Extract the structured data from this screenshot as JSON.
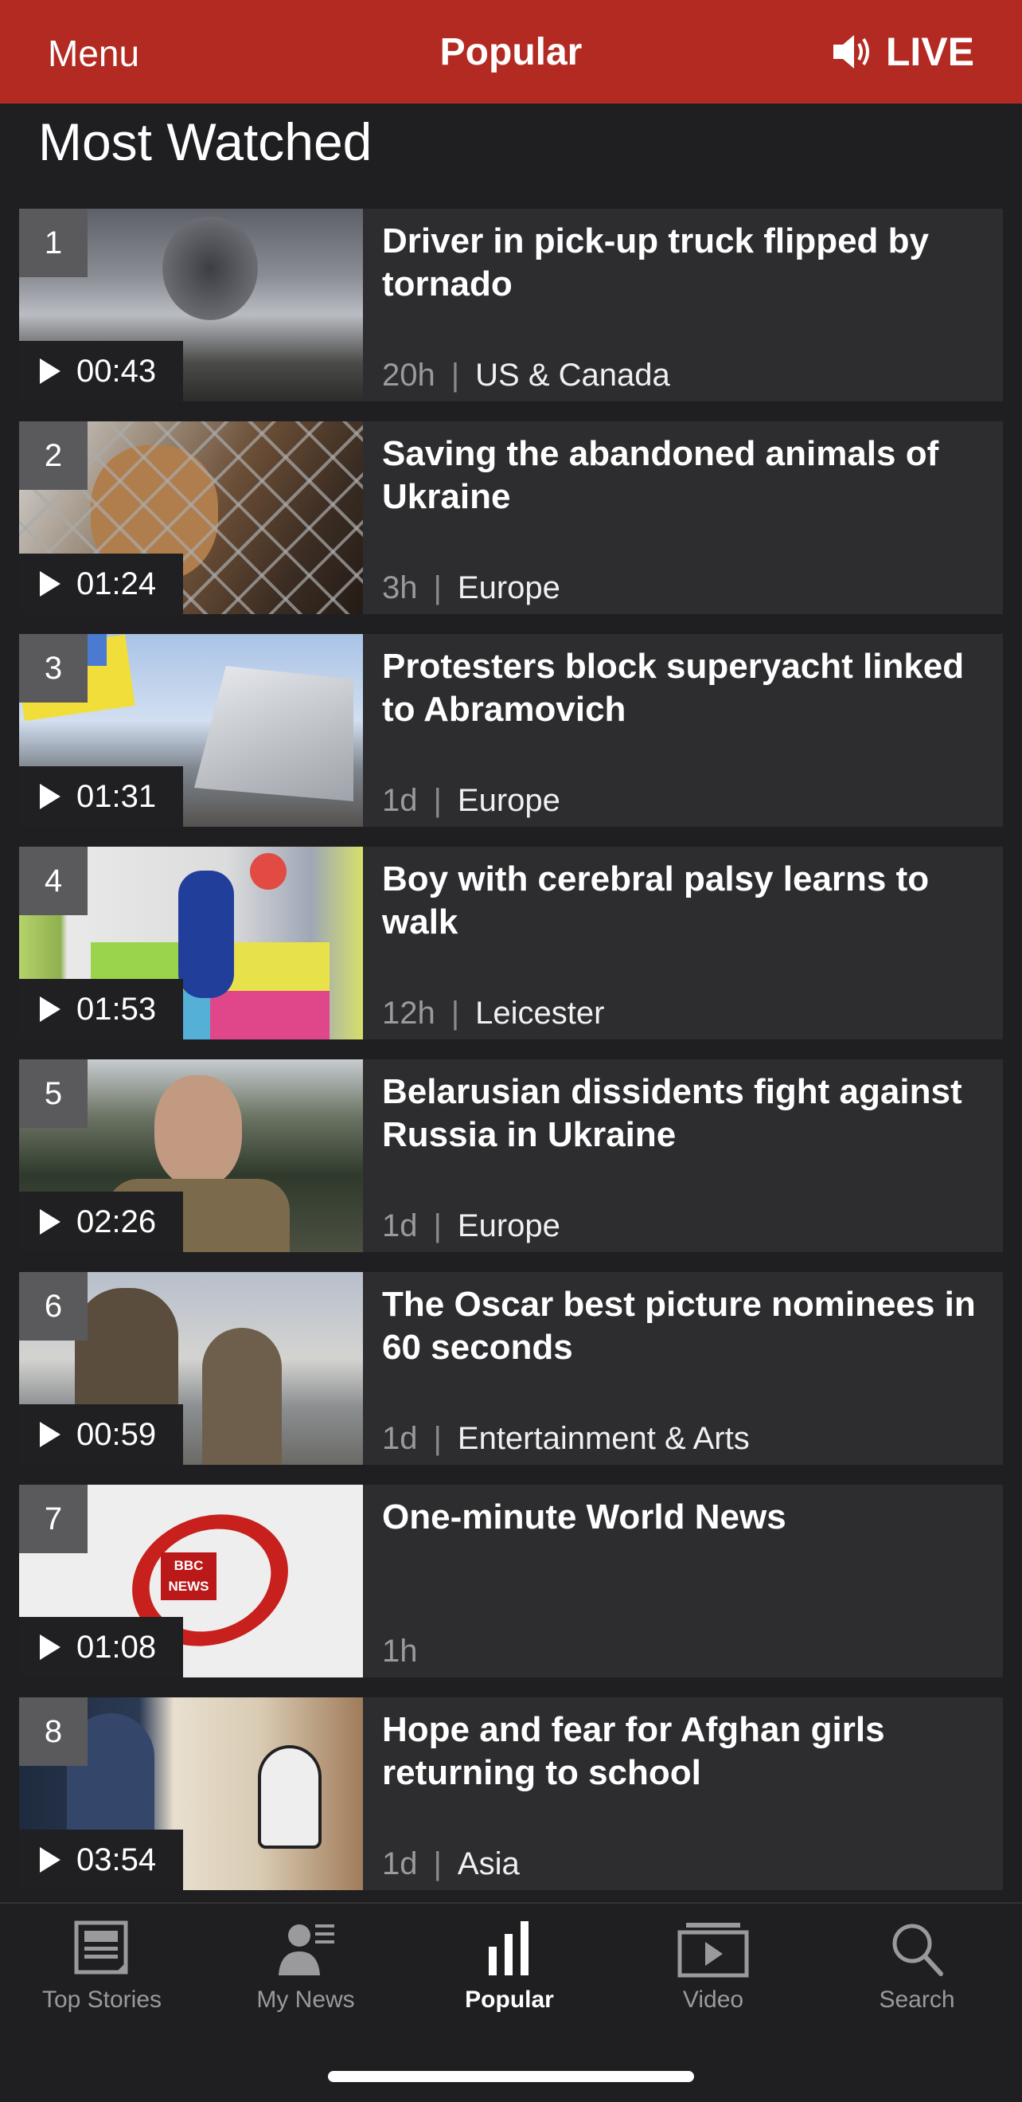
{
  "header": {
    "menu_label": "Menu",
    "title": "Popular",
    "live_label": "LIVE",
    "bg_color": "#b32a23"
  },
  "section_title": "Most Watched",
  "items": [
    {
      "rank": "1",
      "duration": "00:43",
      "headline": "Driver in pick-up truck flipped by tornado",
      "time": "20h",
      "category": "US & Canada"
    },
    {
      "rank": "2",
      "duration": "01:24",
      "headline": "Saving the abandoned animals of Ukraine",
      "time": "3h",
      "category": "Europe"
    },
    {
      "rank": "3",
      "duration": "01:31",
      "headline": "Protesters block superyacht linked to Abramovich",
      "time": "1d",
      "category": "Europe"
    },
    {
      "rank": "4",
      "duration": "01:53",
      "headline": "Boy with cerebral palsy learns to walk",
      "time": "12h",
      "category": "Leicester"
    },
    {
      "rank": "5",
      "duration": "02:26",
      "headline": "Belarusian dissidents fight against Russia in Ukraine",
      "time": "1d",
      "category": "Europe"
    },
    {
      "rank": "6",
      "duration": "00:59",
      "headline": "The Oscar best picture nominees in 60 seconds",
      "time": "1d",
      "category": "Entertainment & Arts"
    },
    {
      "rank": "7",
      "duration": "01:08",
      "headline": "One-minute World News",
      "time": "1h",
      "category": ""
    },
    {
      "rank": "8",
      "duration": "03:54",
      "headline": "Hope and fear for Afghan girls returning to school",
      "time": "1d",
      "category": "Asia"
    }
  ],
  "thumb_logo": {
    "line1": "BBC",
    "line2": "NEWS"
  },
  "tabs": [
    {
      "label": "Top Stories",
      "icon": "newspaper-icon",
      "active": false
    },
    {
      "label": "My News",
      "icon": "person-list-icon",
      "active": false
    },
    {
      "label": "Popular",
      "icon": "bar-chart-icon",
      "active": true
    },
    {
      "label": "Video",
      "icon": "video-icon",
      "active": false
    },
    {
      "label": "Search",
      "icon": "search-icon",
      "active": false
    }
  ]
}
